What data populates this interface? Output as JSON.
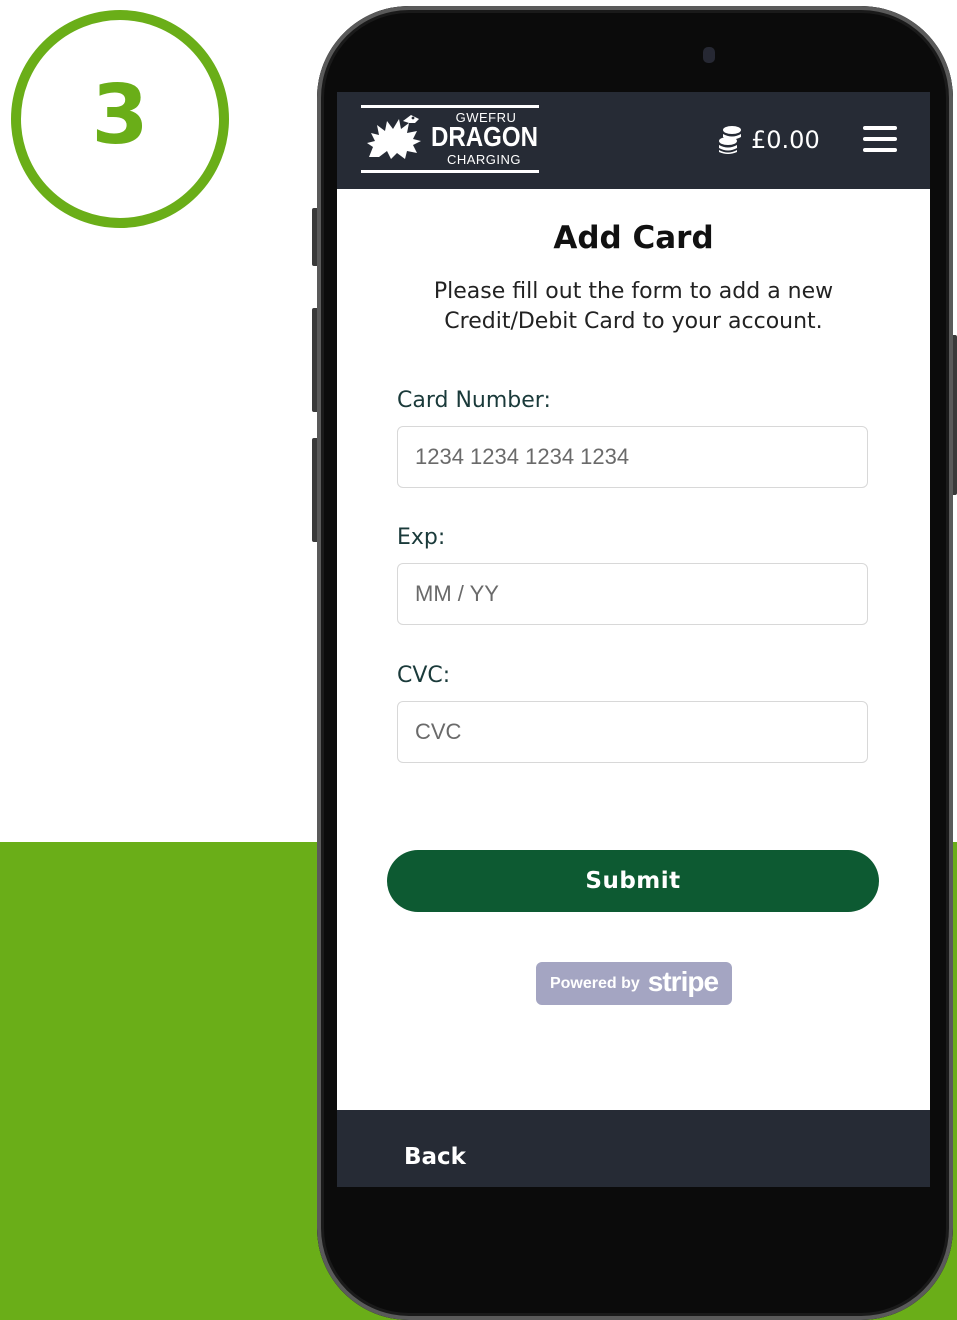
{
  "step": {
    "number": "3"
  },
  "header": {
    "logo": {
      "line1": "GWEFRU",
      "line2": "DRAGON",
      "line3": "CHARGING"
    },
    "balance": "£0.00",
    "balance_icon": "coins-icon",
    "menu_icon": "hamburger-menu-icon"
  },
  "page": {
    "title": "Add Card",
    "subtitle": "Please fill out the form to add a new Credit/Debit Card to your account."
  },
  "form": {
    "card_number": {
      "label": "Card Number:",
      "placeholder": "1234 1234 1234 1234",
      "value": ""
    },
    "exp": {
      "label": "Exp:",
      "placeholder": "MM / YY",
      "value": ""
    },
    "cvc": {
      "label": "CVC:",
      "placeholder": "CVC",
      "value": ""
    },
    "submit_label": "Submit"
  },
  "stripe": {
    "powered_by": "Powered by",
    "brand": "stripe"
  },
  "footer": {
    "back_label": "Back"
  },
  "colors": {
    "brand_green": "#6aae18",
    "header_bg": "#262b35",
    "submit_bg": "#0d5a32",
    "stripe_badge": "#a4a5c2"
  }
}
